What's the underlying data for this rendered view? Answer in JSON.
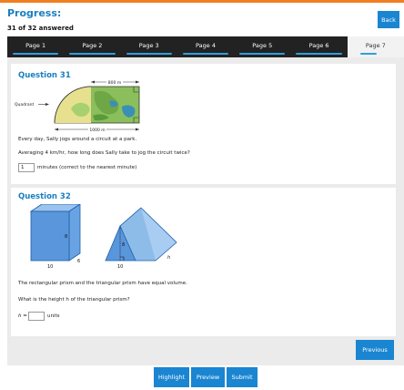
{
  "header": {
    "title": "Progress:",
    "answered": "31 of 32 answered",
    "back_label": "Back"
  },
  "tabs": [
    {
      "label": "Page 1"
    },
    {
      "label": "Page 2"
    },
    {
      "label": "Page 3"
    },
    {
      "label": "Page 4"
    },
    {
      "label": "Page 5"
    },
    {
      "label": "Page 6"
    },
    {
      "label": "Page 7"
    }
  ],
  "q31": {
    "title": "Question 31",
    "figure": {
      "quadrant_label": "Quadrant",
      "top_length": "800 m",
      "bottom_length": "1000 m"
    },
    "text1": "Every day, Sally jogs around a circuit at a park.",
    "text2": "Averaging 4 km/hr, how long does Sally take to jog the circuit twice?",
    "answer_value": "1",
    "answer_suffix": "minutes (correct to the nearest minute)"
  },
  "q32": {
    "title": "Question 32",
    "figure": {
      "prism_height": "8",
      "prism_depth": "6",
      "prism_width": "10",
      "tri_height": "8",
      "tri_base": "10",
      "tri_length": "h"
    },
    "text1": "The rectangular prism and the triangular prism have equal volume.",
    "text2": "What is the height h of the triangular prism?",
    "answer_prefix": "h =",
    "answer_value": "",
    "answer_suffix": "units"
  },
  "footer": {
    "previous_label": "Previous",
    "highlight_label": "Highlight",
    "preview_label": "Preview",
    "submit_label": "Submit"
  },
  "colors": {
    "accent": "#1a85d1",
    "title_blue": "#1a7fc1",
    "top_stripe": "#f07f22",
    "tab_bar": "#222222"
  }
}
